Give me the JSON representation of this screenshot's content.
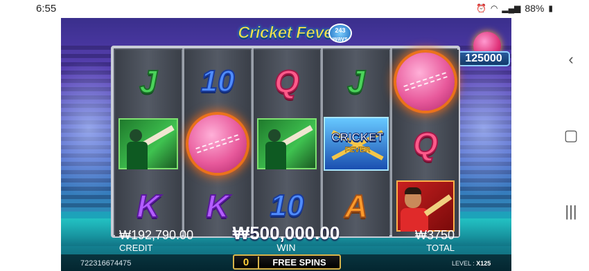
{
  "status_bar": {
    "time": "6:55",
    "battery": "88%",
    "icons": [
      "alarm-icon",
      "wifi-icon",
      "signal-icon",
      "battery-icon"
    ]
  },
  "game": {
    "logo": {
      "title": "Cricket Fever",
      "badge_number": "243",
      "badge_label": "ways"
    },
    "jackpot": {
      "value": "125000"
    },
    "reels": [
      [
        "J",
        "player",
        "K"
      ],
      [
        "10",
        "ball",
        "K"
      ],
      [
        "Q",
        "player",
        "10"
      ],
      [
        "J",
        "wild",
        "A"
      ],
      [
        "ball",
        "Q",
        "batter"
      ]
    ],
    "wild": {
      "line1": "CRICKET",
      "line2": "FEVER"
    },
    "credit": {
      "value": "₩192,790.00",
      "label": "CREDIT"
    },
    "win": {
      "value": "₩500,000.00",
      "label": "WIN"
    },
    "total": {
      "value": "₩3750",
      "label": "TOTAL"
    },
    "game_id": "722316674475",
    "free_spins": {
      "count": "0",
      "label": "FREE SPINS"
    },
    "level": {
      "label": "LEVEL :",
      "value": "X125"
    }
  },
  "colors": {
    "accent": "#ffe24a",
    "jackpot_border": "#8fd0ff",
    "free_spins_border": "#d8b44a"
  }
}
